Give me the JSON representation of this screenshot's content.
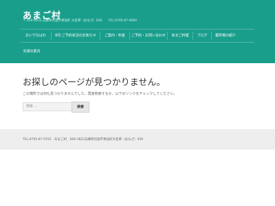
{
  "site": {
    "title": "あまご村",
    "description": "〒 659-0013 兵庫県丹波市青垣町 大名草（おなざ）656　　TEL:0795-87-0000"
  },
  "colors": {
    "header_bg": "#1a9e8c",
    "footer_bg": "#eeeeee"
  },
  "nav": {
    "row1": [
      "おいでなはれ",
      "8月 ご予約状況のお知らせ",
      "ご案内・料金",
      "ご予約・お問い合わせ",
      "あまご料理",
      "ブログ",
      "墓所場の紹介"
    ],
    "row2": [
      "交通の案内"
    ]
  },
  "main": {
    "title": "お探しのページが見つかりません。",
    "message": "この場所では何も見つかりませんでした。再度検索するか、以下のリンクをチェックしてください。",
    "search_placeholder": "検索 …",
    "search_button": "検索"
  },
  "footer": {
    "text": "TEL:0795-87-5555　あまご村　669-3822兵庫県丹波市青垣町大名草（おなざ）656"
  }
}
